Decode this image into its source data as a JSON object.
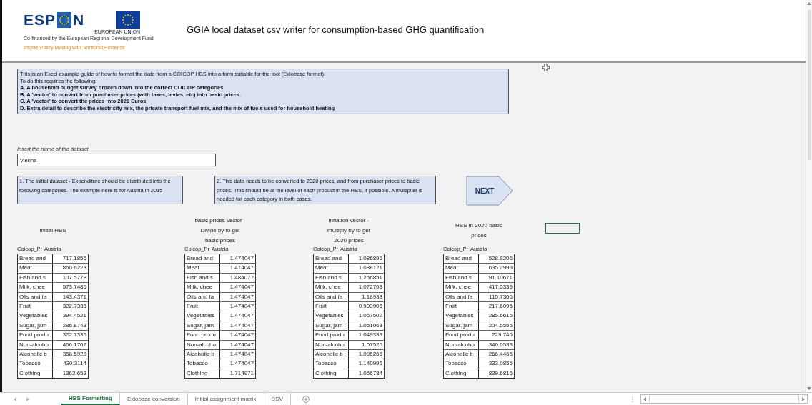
{
  "header": {
    "logo": {
      "wordmark_start": "ESP",
      "wordmark_end": "N",
      "flag_caption": "EUROPEAN UNION",
      "funding_line": "Co-financed by the European Regional Development Fund",
      "tagline": "Inspire Policy Making with Territorial Evidence"
    },
    "title": "GGIA local dataset csv writer for consumption-based GHG quantification"
  },
  "intro_box": {
    "lines": [
      {
        "text": "This is an Excel example guide of how to format the data from a COICOP HBS into a form suitable for the tool (Exiobase format).",
        "bold": false
      },
      {
        "text": "To do this requires the following:",
        "bold": false
      },
      {
        "text": "A. A household budget survey broken down into the correct COICOP categories",
        "bold": true
      },
      {
        "text": "B. A 'vector' to convert from purchaser prices (with taxes, levies, etc) into basic prices.",
        "bold": true
      },
      {
        "text": "C. A 'vector' to convert the prices into 2020 Euros",
        "bold": true
      },
      {
        "text": "D. Extra detail to describe the electricity mix, the pricate transport fuel mix, and the mix of fuels used for household heating",
        "bold": true
      }
    ]
  },
  "dataset_name": {
    "label": "Insert the name of the dataset",
    "value": "Vienna"
  },
  "notes": [
    "1. The initial dataset - Expenditure should be distributed into the following categories. The example here is for Austria in 2015",
    "2. This data needs to be converted to 2020 prices, and from purchaser prices to basic prices. This should be at the level of each product in the HBS, if possible. A multiplier is needed for each category in both cases."
  ],
  "next_button": "NEXT",
  "tables": [
    {
      "heading": [
        "Initial HBS"
      ],
      "column_1": "Coicop_Pr",
      "column_2": "Austria",
      "rows": [
        {
          "label": "Bread and",
          "value": "717.1856"
        },
        {
          "label": "Meat",
          "value": "860.6228"
        },
        {
          "label": "Fish and s",
          "value": "107.5778"
        },
        {
          "label": "Milk, chee",
          "value": "573.7485"
        },
        {
          "label": "Oils and fa",
          "value": "143.4371"
        },
        {
          "label": "Fruit",
          "value": "322.7335"
        },
        {
          "label": "Vegetables",
          "value": "394.4521"
        },
        {
          "label": "Sugar, jam",
          "value": "286.8743"
        },
        {
          "label": "Food produ",
          "value": "322.7335"
        },
        {
          "label": "Non-alcoho",
          "value": "466.1707"
        },
        {
          "label": "Alcoholic b",
          "value": "358.5928"
        },
        {
          "label": "Tobacco",
          "value": "430.3114"
        },
        {
          "label": "Clothing",
          "value": "1362.653"
        }
      ]
    },
    {
      "heading": [
        "basic prices vector -",
        "Divide by to get",
        "basic prices"
      ],
      "column_1": "Coicop_Pr",
      "column_2": "Austria",
      "rows": [
        {
          "label": "Bread and",
          "value": "1.474047"
        },
        {
          "label": "Meat",
          "value": "1.474047"
        },
        {
          "label": "Fish and s",
          "value": "1.484077"
        },
        {
          "label": "Milk, chee",
          "value": "1.474047"
        },
        {
          "label": "Oils and fa",
          "value": "1.474047"
        },
        {
          "label": "Fruit",
          "value": "1.474047"
        },
        {
          "label": "Vegetables",
          "value": "1.474047"
        },
        {
          "label": "Sugar, jam",
          "value": "1.474047"
        },
        {
          "label": "Food produ",
          "value": "1.474047"
        },
        {
          "label": "Non-alcoho",
          "value": "1.474047"
        },
        {
          "label": "Alcoholic b",
          "value": "1.474047"
        },
        {
          "label": "Tobacco",
          "value": "1.474047"
        },
        {
          "label": "Clothing",
          "value": "1.714971"
        }
      ]
    },
    {
      "heading": [
        "inflation vector -",
        "multiply by to get",
        "2020 prices"
      ],
      "column_1": "Coicop_Pr",
      "column_2": "Austria",
      "rows": [
        {
          "label": "Bread and",
          "value": "1.086896"
        },
        {
          "label": "Meat",
          "value": "1.088121"
        },
        {
          "label": "Fish and s",
          "value": "1.256851"
        },
        {
          "label": "Milk, chee",
          "value": "1.072708"
        },
        {
          "label": "Oils and fa",
          "value": "1.18938"
        },
        {
          "label": "Fruit",
          "value": "0.993906"
        },
        {
          "label": "Vegetables",
          "value": "1.067502"
        },
        {
          "label": "Sugar, jam",
          "value": "1.051068"
        },
        {
          "label": "Food produ",
          "value": "1.049333"
        },
        {
          "label": "Non-alcoho",
          "value": "1.07526"
        },
        {
          "label": "Alcoholic b",
          "value": "1.095266"
        },
        {
          "label": "Tobacco",
          "value": "1.140996"
        },
        {
          "label": "Clothing",
          "value": "1.056784"
        }
      ]
    },
    {
      "heading": [
        "HBS in 2020 basic",
        "prices"
      ],
      "column_1": "Coicop_Pr",
      "column_2": "Austria",
      "rows": [
        {
          "label": "Bread and",
          "value": "528.8206"
        },
        {
          "label": "Meat",
          "value": "635.2999"
        },
        {
          "label": "Fish and s",
          "value": "91.10671"
        },
        {
          "label": "Milk, chee",
          "value": "417.5339"
        },
        {
          "label": "Oils and fa",
          "value": "115.7366"
        },
        {
          "label": "Fruit",
          "value": "217.6096"
        },
        {
          "label": "Vegetables",
          "value": "285.6615"
        },
        {
          "label": "Sugar, jam",
          "value": "204.5555"
        },
        {
          "label": "Food produ",
          "value": "229.745"
        },
        {
          "label": "Non-alcoho",
          "value": "340.0533"
        },
        {
          "label": "Alcoholic b",
          "value": "266.4465"
        },
        {
          "label": "Tobacco",
          "value": "333.0855"
        },
        {
          "label": "Clothing",
          "value": "839.6816"
        }
      ]
    }
  ],
  "sheet_tabs": [
    {
      "label": "HBS Formatting",
      "selected": true
    },
    {
      "label": "Exiobase conversion",
      "selected": false
    },
    {
      "label": "Initial assignment matrix",
      "selected": false
    },
    {
      "label": "CSV",
      "selected": false
    }
  ]
}
